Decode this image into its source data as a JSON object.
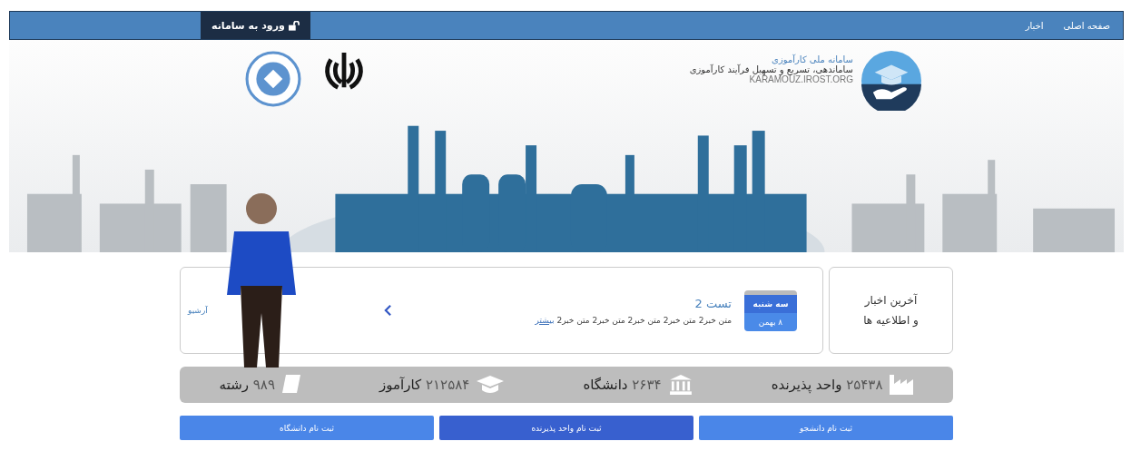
{
  "navbar": {
    "items": [
      {
        "label": "صفحه اصلی"
      },
      {
        "label": "اخبار"
      }
    ],
    "login_button": {
      "label": "ورود به سامانه"
    }
  },
  "header": {
    "title": "سامانه ملی کارآموزی",
    "subtitle": "ساماندهی، تسریع و تسهیل فرآیند کارآموزی",
    "site": "KARAMOUZ.IROST.ORG"
  },
  "news": {
    "heading": [
      "آخرین اخبار",
      "و اطلاعیه ها"
    ],
    "date": {
      "weekday": "سه شنبه",
      "day": "۸ بهمن"
    },
    "title": "تست 2",
    "text": "متن خبر2 متن خبر2 متن خبر2 متن خبر2 متن خبر2",
    "more_link": "بیشتر",
    "archive_link": "آرشیو"
  },
  "stats": [
    {
      "kind": "factory",
      "value": "۲۵۴۳۸",
      "label": "واحد پذیرنده"
    },
    {
      "kind": "university",
      "value": "۲۶۳۴",
      "label": "دانشگاه"
    },
    {
      "kind": "cap",
      "value": "۲۱۲۵۸۴",
      "label": "کارآموز"
    },
    {
      "kind": "book",
      "value": "۹۸۹",
      "label": "رشته"
    }
  ],
  "register_buttons": [
    {
      "label": "ثبت نام دانشجو",
      "selected": false
    },
    {
      "label": "ثبت نام واحد پذیرنده",
      "selected": true
    },
    {
      "label": "ثبت نام دانشگاه",
      "selected": false
    }
  ]
}
